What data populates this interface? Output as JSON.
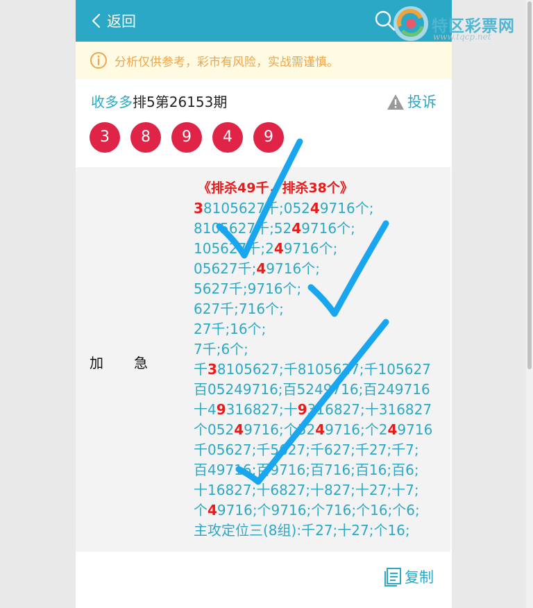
{
  "header": {
    "back_label": "返回",
    "logo_text": "特区彩票网",
    "logo_url": "www.tqcp.net"
  },
  "notice": {
    "text": "分析仅供参考，彩市有风险，实战需谨慎。"
  },
  "post": {
    "source": "收多多",
    "issue": "排5第26153期",
    "complaint_label": "投诉",
    "balls": [
      "3",
      "8",
      "9",
      "4",
      "9"
    ]
  },
  "content": {
    "side_label": "加急",
    "heading": "《排杀49千，排杀38个》",
    "lines": [
      [
        [
          "3",
          1
        ],
        [
          "8105627千;052",
          0
        ],
        [
          "4",
          1
        ],
        [
          "9716个;",
          0
        ]
      ],
      [
        [
          "8105627千;52",
          0
        ],
        [
          "4",
          1
        ],
        [
          "9716个;",
          0
        ]
      ],
      [
        [
          "105627千;2",
          0
        ],
        [
          "4",
          1
        ],
        [
          "9716个;",
          0
        ]
      ],
      [
        [
          "05627千;",
          0
        ],
        [
          "4",
          1
        ],
        [
          "9716个;",
          0
        ]
      ],
      [
        [
          "5627千;9716个;",
          0
        ]
      ],
      [
        [
          "627千;716个;",
          0
        ]
      ],
      [
        [
          "27千;16个;",
          0
        ]
      ],
      [
        [
          "7千;6个;",
          0
        ]
      ],
      [
        [
          "千",
          0
        ],
        [
          "3",
          1
        ],
        [
          "8105627;千8105627;千105627",
          0
        ]
      ],
      [
        [
          "百05249716;百5249716;百249716",
          0
        ]
      ],
      [
        [
          "十4",
          0
        ],
        [
          "9",
          1
        ],
        [
          "316827;十",
          0
        ],
        [
          "9",
          1
        ],
        [
          "316827;十316827",
          0
        ]
      ],
      [
        [
          "个052",
          0
        ],
        [
          "4",
          1
        ],
        [
          "9716;个52",
          0
        ],
        [
          "4",
          1
        ],
        [
          "9716;个2",
          0
        ],
        [
          "4",
          1
        ],
        [
          "9716",
          0
        ]
      ],
      [
        [
          "千05627;千5627;千627;千27;千7;",
          0
        ]
      ],
      [
        [
          "百49716;百9716;百716;百16;百6;",
          0
        ]
      ],
      [
        [
          "十16827;十6827;十827;十27;十7;",
          0
        ]
      ],
      [
        [
          "个",
          0
        ],
        [
          "4",
          1
        ],
        [
          "9716;个9716;个716;个16;个6;",
          0
        ]
      ],
      [
        [
          "主攻定位三(8组):千27;十27;个16;",
          0
        ]
      ]
    ]
  },
  "footer": {
    "copy_label": "复制"
  },
  "colors": {
    "header": "#2ba8c6",
    "notice_bg": "#fffbe3",
    "notice_text": "#eda54b",
    "ball": "#e02448",
    "highlight": "#ea1a1a",
    "check_marks": "#1aa6ee"
  }
}
